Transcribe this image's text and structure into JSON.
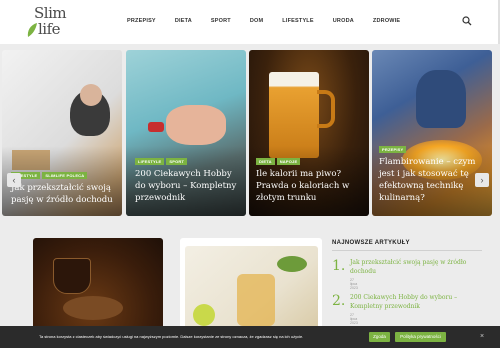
{
  "logo": {
    "line1": "Slim",
    "line2": "life"
  },
  "nav": [
    "PRZEPISY",
    "DIETA",
    "SPORT",
    "DOM",
    "LIFESTYLE",
    "URODA",
    "ZDROWIE"
  ],
  "slider": {
    "prev": "‹",
    "next": "›",
    "slides": [
      {
        "tags": [
          "LIFESTYLE",
          "SLIMLIFE POLECA"
        ],
        "title": "Jak przekształcić swoją pasję w źródło dochodu"
      },
      {
        "tags": [
          "LIFESTYLE",
          "SPORT"
        ],
        "title": "200 Ciekawych Hobby do wyboru – Kompletny przewodnik"
      },
      {
        "tags": [
          "DIETA",
          "NAPOJE"
        ],
        "title": "Ile kalorii ma piwo? Prawda o kaloriach w złotym trunku"
      },
      {
        "tags": [
          "PRZEPISY"
        ],
        "title": "Flambirowanie – czym jest i jak stosować tę efektowną technikę kulinarną?"
      }
    ]
  },
  "sidebar": {
    "title": "NAJNOWSZE ARTYKUŁY",
    "items": [
      {
        "num": "1.",
        "title": "Jak przekształcić swoją pasję w źródło dochodu",
        "date": "27 lipca 2023"
      },
      {
        "num": "2.",
        "title": "200 Ciekawych Hobby do wyboru – Kompletny przewodnik",
        "date": "27 lipca 2023"
      }
    ]
  },
  "cookie": {
    "text": "Ta strona korzysta z ciasteczek aby świadczyć usługi na najwyższym poziomie. Dalsze korzystanie ze strony oznacza, że zgadzasz się na ich użycie.",
    "accept": "Zgoda",
    "policy": "Polityka prywatności",
    "close": "×"
  },
  "colors": {
    "accent": "#7cb342",
    "cookie_bg": "#2b2b2b"
  }
}
